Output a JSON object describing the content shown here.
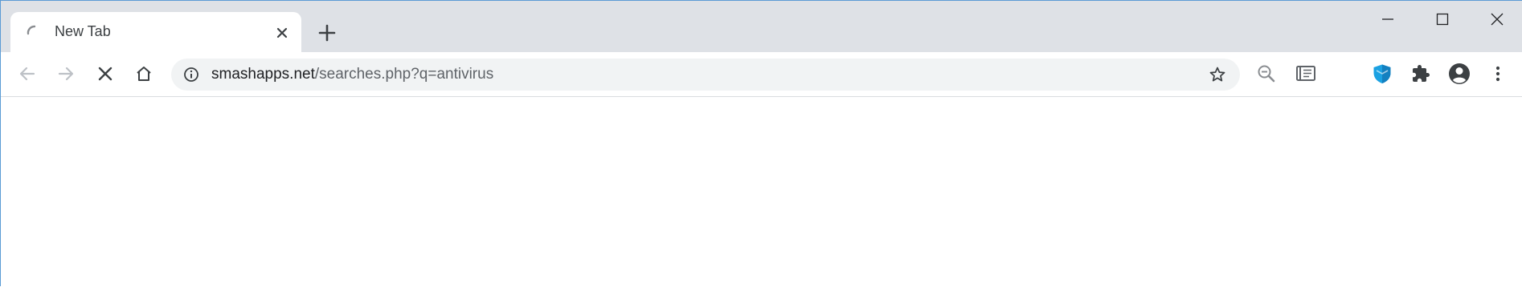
{
  "tabs": [
    {
      "title": "New Tab",
      "loading": true
    }
  ],
  "toolbar": {
    "url_domain": "smashapps.net",
    "url_path": "/searches.php?q=antivirus"
  },
  "colors": {
    "tabstrip_bg": "#dee1e6",
    "omnibox_bg": "#f1f3f4",
    "extension_shield": "#1ba1e2",
    "icon_dark": "#5f6368",
    "icon_disabled": "#bdc1c6"
  },
  "icons": {
    "tab": [
      "loading-spinner-icon",
      "close-icon"
    ],
    "tabstrip": [
      "plus-icon",
      "minimize-icon",
      "maximize-icon",
      "close-icon"
    ],
    "toolbar": [
      "back-arrow-icon",
      "forward-arrow-icon",
      "stop-icon",
      "home-icon",
      "info-icon",
      "star-icon",
      "zoom-out-icon",
      "reader-icon",
      "shield-icon",
      "puzzle-icon",
      "account-icon",
      "menu-dots-icon"
    ]
  }
}
